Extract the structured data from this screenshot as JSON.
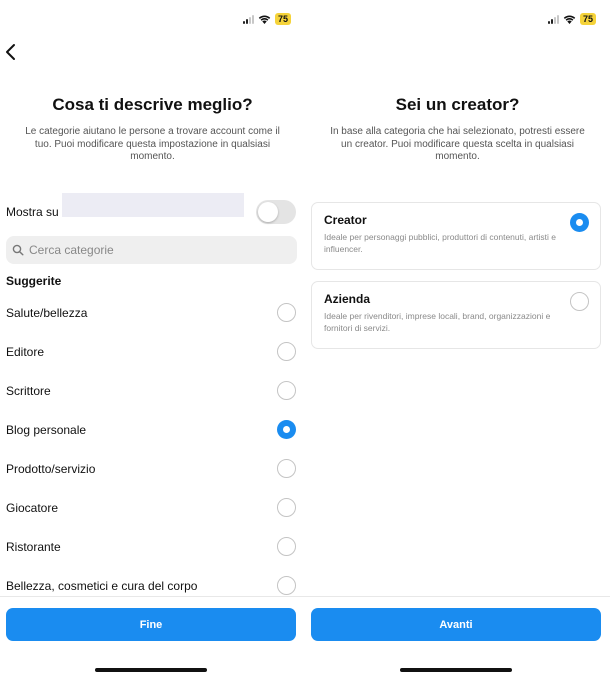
{
  "status_bar": {
    "battery": "75"
  },
  "left": {
    "title": "Cosa ti descrive meglio?",
    "subtitle": "Le categorie aiutano le persone a trovare account come il tuo. Puoi modificare questa impostazione in qualsiasi momento.",
    "toggle_label": "Mostra su",
    "search_placeholder": "Cerca categorie",
    "section_title": "Suggerite",
    "categories": [
      {
        "label": "Salute/bellezza",
        "selected": false
      },
      {
        "label": "Editore",
        "selected": false
      },
      {
        "label": "Scrittore",
        "selected": false
      },
      {
        "label": "Blog personale",
        "selected": true
      },
      {
        "label": "Prodotto/servizio",
        "selected": false
      },
      {
        "label": "Giocatore",
        "selected": false
      },
      {
        "label": "Ristorante",
        "selected": false
      },
      {
        "label": "Bellezza, cosmetici e cura del corpo",
        "selected": false
      }
    ],
    "button_label": "Fine"
  },
  "right": {
    "title": "Sei un creator?",
    "subtitle": "In base alla categoria che hai selezionato, potresti essere un creator. Puoi modificare questa scelta in qualsiasi momento.",
    "options": [
      {
        "title": "Creator",
        "description": "Ideale per personaggi pubblici, produttori di contenuti, artisti e influencer.",
        "selected": true
      },
      {
        "title": "Azienda",
        "description": "Ideale per rivenditori, imprese locali, brand, organizzazioni e fornitori di servizi.",
        "selected": false
      }
    ],
    "button_label": "Avanti"
  },
  "colors": {
    "accent": "#1a8cf0",
    "battery": "#f5d33a"
  }
}
